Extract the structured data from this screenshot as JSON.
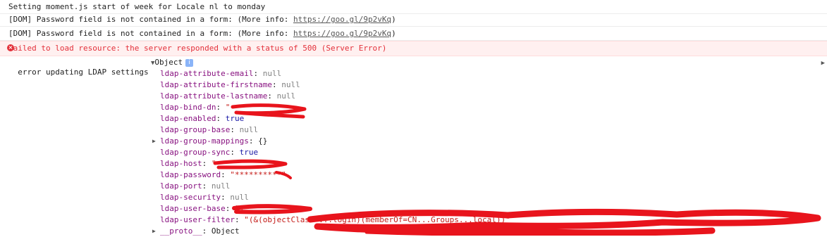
{
  "console": {
    "messages": [
      {
        "text": "Setting moment.js start of week for Locale nl to monday"
      },
      {
        "text": "[DOM] Password field is not contained in a form: (More info: ",
        "link": "https://goo.gl/9p2vKq",
        "suffix": ")"
      },
      {
        "text": "[DOM] Password field is not contained in a form: (More info: ",
        "link": "https://goo.gl/9p2vKq",
        "suffix": ")"
      }
    ],
    "error": {
      "icon": "error-icon",
      "text": "Failed to load resource: the server responded with a status of 500 (Server Error)"
    },
    "log": {
      "label": "error updating LDAP settings",
      "object_label": "Object",
      "info_badge": "i",
      "properties": [
        {
          "key": "ldap-attribute-email",
          "value": "null",
          "type": "null"
        },
        {
          "key": "ldap-attribute-firstname",
          "value": "null",
          "type": "null"
        },
        {
          "key": "ldap-attribute-lastname",
          "value": "null",
          "type": "null"
        },
        {
          "key": "ldap-bind-dn",
          "value": "\"",
          "type": "str"
        },
        {
          "key": "ldap-enabled",
          "value": "true",
          "type": "bool"
        },
        {
          "key": "ldap-group-base",
          "value": "null",
          "type": "null"
        },
        {
          "key": "ldap-group-mappings",
          "value": "{}",
          "type": "obj"
        },
        {
          "key": "ldap-group-sync",
          "value": "true",
          "type": "bool"
        },
        {
          "key": "ldap-host",
          "value": "\"",
          "type": "str"
        },
        {
          "key": "ldap-password",
          "value": "\"**********\"",
          "type": "str"
        },
        {
          "key": "ldap-port",
          "value": "null",
          "type": "null"
        },
        {
          "key": "ldap-security",
          "value": "null",
          "type": "null"
        },
        {
          "key": "ldap-user-base",
          "value": "\"1\"",
          "type": "str"
        },
        {
          "key": "ldap-user-filter",
          "value": "\"(&(objectClass=...login)(memberOf=CN...Groups...local))\"",
          "type": "str"
        },
        {
          "key": "__proto__",
          "value": "Object",
          "type": "proto"
        }
      ]
    }
  },
  "colors": {
    "redaction": "#e8141c",
    "error_bg": "#fff0f0",
    "error_text": "#e3303a",
    "key": "#881280"
  }
}
